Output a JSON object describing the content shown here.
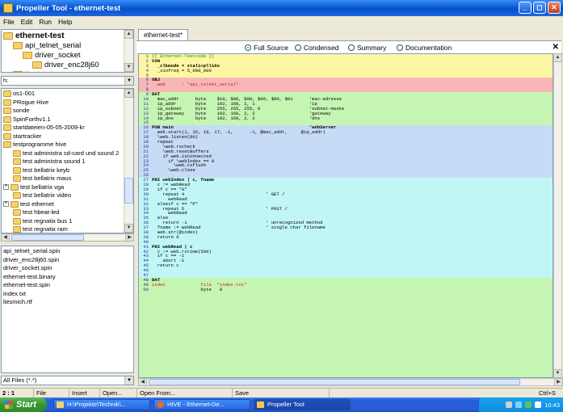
{
  "window": {
    "title": "Propeller Tool - ethernet-test"
  },
  "menu": [
    "File",
    "Edit",
    "Run",
    "Help"
  ],
  "object_tree": {
    "items": [
      {
        "label": "ethernet-test",
        "level": 0
      },
      {
        "label": "api_telnet_serial",
        "level": 1
      },
      {
        "label": "driver_socket",
        "level": 2
      },
      {
        "label": "driver_enc28j60",
        "level": 3
      },
      {
        "label": "jkodyjutj",
        "level": 1
      }
    ]
  },
  "drive": {
    "value": "h:"
  },
  "dirs": [
    {
      "label": "os1-001",
      "exp": ""
    },
    {
      "label": "PRogue Hive",
      "exp": ""
    },
    {
      "label": "sonde",
      "exp": ""
    },
    {
      "label": "SpinForthv1.1",
      "exp": ""
    },
    {
      "label": "startdateien-05-05-2009-kr",
      "exp": ""
    },
    {
      "label": "startracker",
      "exp": ""
    },
    {
      "label": "testprogramme hive",
      "exp": ""
    },
    {
      "label": "test administra sd-card und sound 2",
      "exp": ""
    },
    {
      "label": "test administra sound 1",
      "exp": ""
    },
    {
      "label": "test bellatrix keyb",
      "exp": ""
    },
    {
      "label": "test bellatrix maus",
      "exp": ""
    },
    {
      "label": "test bellatrix vga",
      "exp": "+"
    },
    {
      "label": "test bellatrix video",
      "exp": ""
    },
    {
      "label": "test ethernet",
      "exp": "+"
    },
    {
      "label": "test hbeat-led",
      "exp": ""
    },
    {
      "label": "test regnatix bus 1",
      "exp": ""
    },
    {
      "label": "test regnatix ram",
      "exp": ""
    }
  ],
  "files": [
    "api_telnet_serial.spin",
    "driver_enc28j60.spin",
    "driver_socket.spin",
    "ethernet-test.binary",
    "ethernet-test.spin",
    "index.txt",
    "liesmich.rtf"
  ],
  "filter": {
    "value": "All Files (*.*)"
  },
  "editor_tab": "ethernet-test*",
  "views": {
    "full": "Full Source",
    "condensed": "Condensed",
    "summary": "Summary",
    "documentation": "Documentation"
  },
  "code_lines": [
    {
      "n": "1",
      "t": "{{ Ethernet-Testcode }}",
      "c": "com"
    },
    {
      "n": "2",
      "t": "CON",
      "c": "kw"
    },
    {
      "n": "3",
      "t": "  _clkmode = xtal1+pll16x",
      "c": "kw"
    },
    {
      "n": "4",
      "t": "  _xinfreq = 5_000_000",
      "c": ""
    },
    {
      "n": "5",
      "t": "",
      "c": ""
    },
    {
      "n": "6",
      "t": "OBJ",
      "c": "kw"
    },
    {
      "n": "7",
      "t": "  web      : \"api_telnet_serial\"",
      "c": "str"
    },
    {
      "n": "8",
      "t": "",
      "c": ""
    },
    {
      "n": "9",
      "t": "DAT",
      "c": "kw"
    },
    {
      "n": "10",
      "t": "  mac_addr      byte    $10, $00, $00, $00, $00, $01      'mac-adresse",
      "c": ""
    },
    {
      "n": "11",
      "t": "  ip_addr       byte    192, 168, 2, 1                    'ip",
      "c": ""
    },
    {
      "n": "12",
      "t": "  ip_subnet     byte    255, 255, 255, 0                  'subnet-maske",
      "c": ""
    },
    {
      "n": "13",
      "t": "  ip_gateway    byte    192, 168, 2, 2                    'gateway",
      "c": ""
    },
    {
      "n": "14",
      "t": "  ip_dns        byte    192, 169, 2, 2                    'dns",
      "c": ""
    },
    {
      "n": "15",
      "t": "",
      "c": ""
    },
    {
      "n": "16",
      "t": "PUB main                                                  'webServer",
      "c": "kw"
    },
    {
      "n": "17",
      "t": "  web.start(1, 15, 16, 17, -1,      -1, @mac_addr,     @ip_addr)",
      "c": ""
    },
    {
      "n": "18",
      "t": "  \\web.listen(80)",
      "c": ""
    },
    {
      "n": "19",
      "t": "  repeat",
      "c": ""
    },
    {
      "n": "20",
      "t": "    \\web.rxcheck",
      "c": ""
    },
    {
      "n": "21",
      "t": "    \\web.resetBuffers",
      "c": ""
    },
    {
      "n": "22",
      "t": "    if web.isConnected",
      "c": ""
    },
    {
      "n": "23",
      "t": "      if \\webIndex == 0",
      "c": ""
    },
    {
      "n": "24",
      "t": "        \\web.txflush",
      "c": ""
    },
    {
      "n": "25",
      "t": "      \\web.close",
      "c": ""
    },
    {
      "n": "26",
      "t": "",
      "c": ""
    },
    {
      "n": "27",
      "t": "PRI webIndex | c, fname",
      "c": "kw"
    },
    {
      "n": "28",
      "t": "  c := webRead",
      "c": ""
    },
    {
      "n": "29",
      "t": "  if c == \"G\"",
      "c": ""
    },
    {
      "n": "30",
      "t": "    repeat 4                              ' GET /",
      "c": ""
    },
    {
      "n": "31",
      "t": "      webRead",
      "c": ""
    },
    {
      "n": "32",
      "t": "  elseif c == \"P\"",
      "c": ""
    },
    {
      "n": "33",
      "t": "    repeat 5                              ' POST /",
      "c": ""
    },
    {
      "n": "34",
      "t": "      webRead",
      "c": ""
    },
    {
      "n": "35",
      "t": "  else",
      "c": ""
    },
    {
      "n": "36",
      "t": "    return -1                             ' unrecognized method",
      "c": ""
    },
    {
      "n": "37",
      "t": "  fname := webRead                        ' single char filename",
      "c": ""
    },
    {
      "n": "38",
      "t": "  web.str(@index)",
      "c": ""
    },
    {
      "n": "39",
      "t": "  return 0",
      "c": ""
    },
    {
      "n": "40",
      "t": "",
      "c": ""
    },
    {
      "n": "41",
      "t": "PRI webRead | c",
      "c": "kw"
    },
    {
      "n": "42",
      "t": "  c := web.rxtime(500)",
      "c": ""
    },
    {
      "n": "43",
      "t": "  if c == -1",
      "c": ""
    },
    {
      "n": "44",
      "t": "    abort -1",
      "c": ""
    },
    {
      "n": "45",
      "t": "  return c",
      "c": ""
    },
    {
      "n": "46",
      "t": "",
      "c": ""
    },
    {
      "n": "47",
      "t": "",
      "c": ""
    },
    {
      "n": "48",
      "t": "DAT",
      "c": "kw"
    },
    {
      "n": "49",
      "t": "index             file  \"index.txt\"",
      "c": "str"
    },
    {
      "n": "50",
      "t": "                  byte   0",
      "c": ""
    }
  ],
  "code_blocks": [
    {
      "from": 1,
      "to": 5,
      "color": "#fdf7a3"
    },
    {
      "from": 6,
      "to": 8,
      "color": "#f7b7b7"
    },
    {
      "from": 9,
      "to": 15,
      "color": "#c5f5b2"
    },
    {
      "from": 16,
      "to": 26,
      "color": "#c6dbf6"
    },
    {
      "from": 27,
      "to": 47,
      "color": "#c1f6f6"
    },
    {
      "from": 48,
      "to": 50,
      "color": "#c5f5b2"
    }
  ],
  "status": {
    "pos": "2 : 1",
    "file": "File",
    "insert": "Insert",
    "open": "Open...",
    "open_from": "Open From...",
    "save": "Save",
    "shortcut": "Ctrl+S"
  },
  "taskbar": {
    "start": "Start",
    "tasks": [
      "H:\\Projekte\\Technik\\...",
      "HIVE - Ethernet-De...",
      "Propeller Tool"
    ],
    "clock": "10:43"
  }
}
